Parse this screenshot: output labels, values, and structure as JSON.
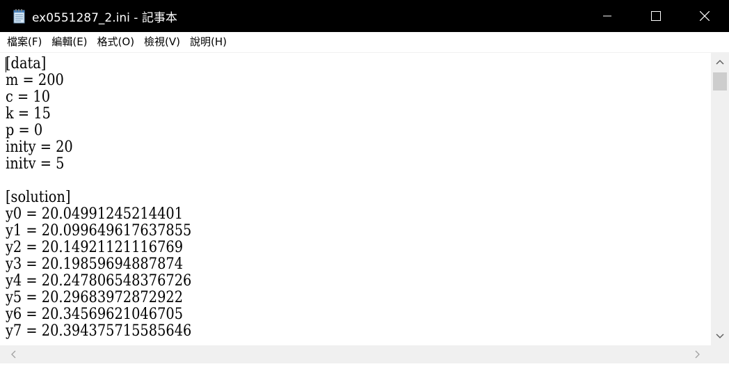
{
  "window": {
    "title": "ex0551287_2.ini - 記事本",
    "icon": "notepad-icon"
  },
  "menubar": {
    "items": [
      {
        "label": "檔案(F)"
      },
      {
        "label": "編輯(E)"
      },
      {
        "label": "格式(O)"
      },
      {
        "label": "檢視(V)"
      },
      {
        "label": "說明(H)"
      }
    ]
  },
  "editor": {
    "lines": [
      "[data]",
      "m = 200",
      "c = 10",
      "k = 15",
      "p = 0",
      "inity = 20",
      "initv = 5",
      "",
      "[solution]",
      "y0 = 20.04991245214401",
      "y1 = 20.099649617637855",
      "y2 = 20.14921121116769",
      "y3 = 20.19859694887874",
      "y4 = 20.247806548376726",
      "y5 = 20.29683972872922",
      "y6 = 20.34569621046705",
      "y7 = 20.394375715585646"
    ]
  },
  "colors": {
    "titlebar_bg": "#000000",
    "titlebar_fg": "#ffffff",
    "scrollbar_bg": "#f0f0f0",
    "scrollbar_thumb": "#cdcdcd"
  }
}
